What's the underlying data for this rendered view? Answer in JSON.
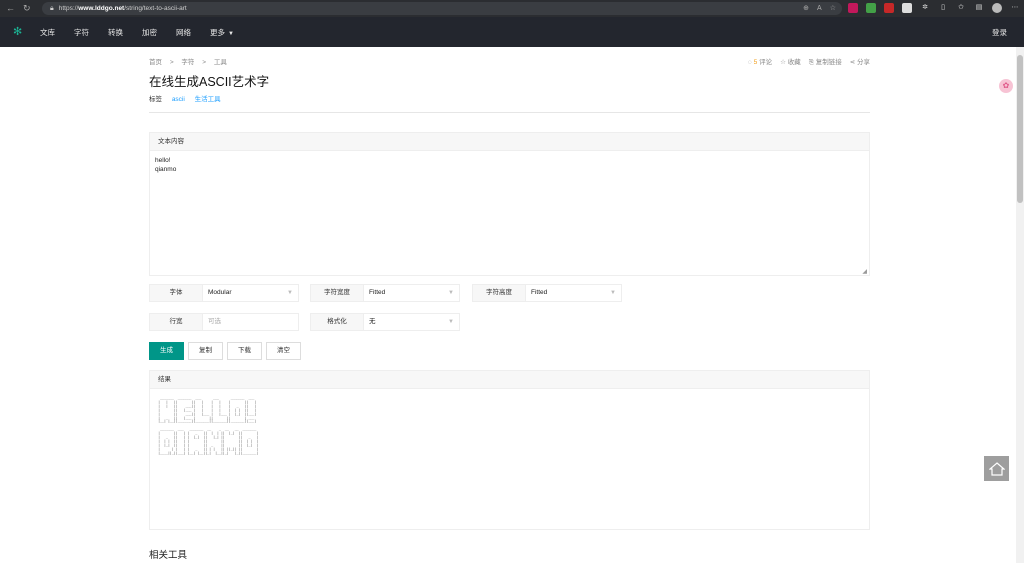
{
  "browser": {
    "url_prefix": "https://",
    "url_host": "www.lddgo.net",
    "url_path": "/string/text-to-ascii-art"
  },
  "header": {
    "menu": [
      "文库",
      "字符",
      "转换",
      "加密",
      "网络",
      "更多"
    ],
    "login": "登录"
  },
  "breadcrumb": [
    "首页",
    ">",
    "字符",
    ">",
    "工具"
  ],
  "actions": {
    "comments_count": "5",
    "comments": "评论",
    "favorite": "收藏",
    "copy_link": "复制链接",
    "share": "分享"
  },
  "page_title": "在线生成ASCII艺术字",
  "tags": {
    "label": "标签",
    "items": [
      "ascii",
      "生活工具"
    ]
  },
  "text_panel": {
    "heading": "文本内容",
    "value": "hello!\nqianmo"
  },
  "options": {
    "font_label": "字体",
    "font_value": "Modular",
    "width_label": "字符宽度",
    "width_value": "Fitted",
    "height_label": "字符高度",
    "height_value": "Fitted",
    "line_width_label": "行宽",
    "line_width_placeholder": "可选",
    "format_label": "格式化",
    "format_value": "无"
  },
  "buttons": {
    "generate": "生成",
    "copy": "复制",
    "download": "下载",
    "clear": "清空"
  },
  "result": {
    "heading": "结果",
    "ascii": " _______  _______  ___      ___      _______  ___\n|   |   ||       ||   |    |   |    |       ||   |\n|   |   ||    ___||   |    |   |    |   _   ||   |\n|       ||   |___ |   |    |   |    |  | |  ||   |\n|       ||    ___||   |___ |   |___ |  |_|  ||___|\n|   _   ||   |___ |       ||       ||       | ___\n|__| |__||_______||_______||_______||_______||___|\n\n _______  ___   _______  __    _  __   __  _______\n|       ||   | |   _   ||  |  | ||  |_|  ||       |\n|   _   ||   | |  |_|  ||   |_| ||       ||   _   |\n|  | |  ||   | |       ||       ||       ||  | |  |\n|  |_|  ||   | |       ||  _    ||       ||  |_|  |\n|      | |   | |   _   || | |   || ||_|| ||       |\n|____||_||___| |__| |__||_|  |__||_|   |_||_______|"
  },
  "related_heading": "相关工具"
}
